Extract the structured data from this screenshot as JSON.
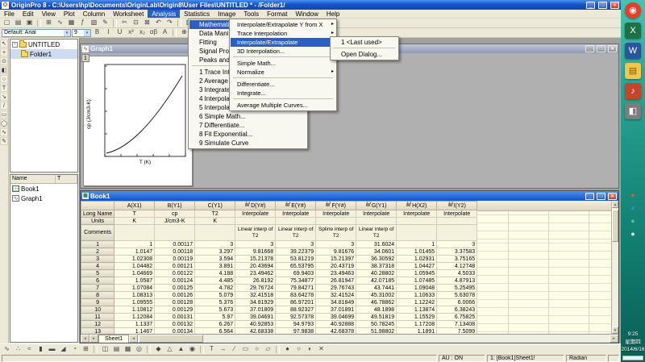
{
  "window": {
    "title": "OriginPro 8 - C:\\Users\\hp\\Documents\\OriginLab\\Origin8\\User Files\\UNTITLED * - /Folder1/",
    "app_icon_glyph": "O"
  },
  "window_controls": {
    "minimize": "_",
    "maximize": "□",
    "close": "✕"
  },
  "glyphs": {
    "submenu_arrow": "▸",
    "dropdown_arrow": "▾",
    "scroll_up": "▴",
    "scroll_down": "▾",
    "scroll_left": "◂",
    "scroll_right": "▸",
    "collapse": "-"
  },
  "menu_bar": {
    "items": [
      {
        "label": "File"
      },
      {
        "label": "Edit"
      },
      {
        "label": "View"
      },
      {
        "label": "Plot"
      },
      {
        "label": "Column"
      },
      {
        "label": "Worksheet"
      },
      {
        "label": "Analysis",
        "active": true
      },
      {
        "label": "Statistics"
      },
      {
        "label": "Image"
      },
      {
        "label": "Tools"
      },
      {
        "label": "Format"
      },
      {
        "label": "Window"
      },
      {
        "label": "Help"
      }
    ]
  },
  "analysis_menu": {
    "items": [
      {
        "label": "Mathematics",
        "sub": true,
        "hl": true
      },
      {
        "label": "Data Manipulation",
        "sub": true
      },
      {
        "label": "Fitting",
        "sub": true
      },
      {
        "label": "Signal Processing",
        "sub": true
      },
      {
        "label": "Peaks and Baseline",
        "sub": true
      },
      {
        "sep": true
      },
      {
        "label": "1 Trace Interpolation..."
      },
      {
        "label": "2 Average Multiple Curves..."
      },
      {
        "label": "3 Integrate..."
      },
      {
        "label": "4 Interpolate/Extrapolate Y from X..."
      },
      {
        "label": "5 Interpolate/Extrapolate..."
      },
      {
        "label": "6 Simple Math..."
      },
      {
        "label": "7 Differentiate..."
      },
      {
        "label": "8 Fit Exponential..."
      },
      {
        "label": "9 Simulate Curve"
      }
    ]
  },
  "mathematics_menu": {
    "items": [
      {
        "label": "Interpolate/Extrapolate Y from X",
        "sub": true
      },
      {
        "label": "Trace Interpolation",
        "sub": true
      },
      {
        "label": "Interpolate/Extrapolate",
        "sub": true,
        "hl": true
      },
      {
        "label": "3D Interpolation..."
      },
      {
        "sep": true
      },
      {
        "label": "Simple Math..."
      },
      {
        "label": "Normalize",
        "sub": true
      },
      {
        "sep": true
      },
      {
        "label": "Differentiate..."
      },
      {
        "label": "Integrate..."
      },
      {
        "sep": true
      },
      {
        "label": "Average Multiple Curves..."
      }
    ]
  },
  "interpolate_menu": {
    "items": [
      {
        "label": "1 <Last used>"
      },
      {
        "sep": true
      },
      {
        "label": "Open Dialog..."
      }
    ]
  },
  "toolbars": {
    "standard": [
      {
        "name": "new-project-icon",
        "glyph": "▢"
      },
      {
        "name": "open-project-icon",
        "glyph": "▤"
      },
      {
        "name": "save-project-icon",
        "glyph": "▣"
      },
      "|",
      {
        "name": "new-workbook-icon",
        "glyph": "⊞"
      },
      {
        "name": "new-graph-icon",
        "glyph": "∿"
      },
      {
        "name": "new-matrix-icon",
        "glyph": "▦"
      },
      {
        "name": "new-function-icon",
        "glyph": "ƒ"
      },
      {
        "name": "new-layout-icon",
        "glyph": "▧"
      },
      {
        "name": "new-notes-icon",
        "glyph": "✎"
      },
      "|",
      {
        "name": "cut-icon",
        "glyph": "✂"
      },
      {
        "name": "copy-icon",
        "glyph": "⊡"
      },
      {
        "name": "paste-icon",
        "glyph": "⊠"
      },
      {
        "name": "undo-icon",
        "glyph": "↶"
      },
      {
        "name": "redo-icon",
        "glyph": "↷"
      },
      "|",
      {
        "name": "project-explorer-icon",
        "glyph": "▥"
      },
      {
        "name": "results-log-icon",
        "glyph": "≡"
      },
      {
        "name": "script-window-icon",
        "glyph": "Σ"
      },
      {
        "name": "code-builder-icon",
        "glyph": "◫"
      },
      {
        "name": "help-icon",
        "glyph": "?"
      }
    ],
    "format": {
      "font_combo": "Default: Arial",
      "size_combo": "9",
      "buttons": [
        {
          "name": "bold-button",
          "glyph": "B"
        },
        {
          "name": "italic-button",
          "glyph": "I"
        },
        {
          "name": "underline-button",
          "glyph": "U"
        },
        {
          "name": "superscript-button",
          "glyph": "x²"
        },
        {
          "name": "subscript-button",
          "glyph": "x₂"
        },
        {
          "name": "greek-button",
          "glyph": "αβ"
        },
        {
          "name": "font-color-button",
          "glyph": "A"
        }
      ],
      "extra": [
        {
          "name": "add-layer-icon",
          "glyph": "⊕"
        },
        {
          "name": "extract-layer-icon",
          "glyph": "⊖"
        },
        {
          "name": "merge-graph-icon",
          "glyph": "⊞"
        },
        {
          "name": "rescale-axes-icon",
          "glyph": "⇄"
        },
        {
          "name": "zoom-in-icon",
          "glyph": "+"
        },
        {
          "name": "zoom-out-icon",
          "glyph": "−"
        },
        {
          "name": "whole-page-view-icon",
          "glyph": "▭"
        },
        {
          "name": "duplicate-window-icon",
          "glyph": "◫"
        }
      ]
    },
    "bottom": [
      [
        {
          "name": "line-plot-icon",
          "glyph": "∿"
        },
        {
          "name": "scatter-plot-icon",
          "glyph": "∴"
        },
        {
          "name": "line-symbol-plot-icon",
          "glyph": "≈"
        },
        {
          "name": "column-plot-icon",
          "glyph": "▮"
        },
        {
          "name": "bar-plot-icon",
          "glyph": "▬"
        },
        {
          "name": "area-plot-icon",
          "glyph": "◢"
        },
        {
          "name": "pie-chart-icon",
          "glyph": "◔"
        },
        {
          "name": "template-library-icon",
          "glyph": "⊞"
        }
      ],
      [
        {
          "name": "double-y-plot-icon",
          "glyph": "◫"
        },
        {
          "name": "stack-plot-icon",
          "glyph": "▤"
        },
        {
          "name": "multi-panel-plot-icon",
          "glyph": "▦"
        },
        {
          "name": "polar-plot-icon",
          "glyph": "◎"
        }
      ],
      [
        {
          "name": "3d-scatter-icon",
          "glyph": "◆"
        },
        {
          "name": "3d-surface-icon",
          "glyph": "△"
        },
        {
          "name": "3d-bar-icon",
          "glyph": "▲"
        },
        {
          "name": "contour-plot-icon",
          "glyph": "◉"
        }
      ],
      [
        {
          "name": "add-text-icon",
          "glyph": "T"
        },
        {
          "name": "add-arrow-icon",
          "glyph": "→"
        },
        {
          "name": "add-line-icon",
          "glyph": "∕"
        },
        {
          "name": "add-rectangle-icon",
          "glyph": "▭"
        },
        {
          "name": "add-circle-icon",
          "glyph": "○"
        },
        {
          "name": "add-polygon-icon",
          "glyph": "▱"
        }
      ],
      [
        {
          "name": "mask-points-icon",
          "glyph": "●"
        },
        {
          "name": "unmask-points-icon",
          "glyph": "○"
        },
        {
          "name": "toggle-mask-icon",
          "glyph": "◐"
        },
        {
          "name": "clear-mask-icon",
          "glyph": "✕"
        }
      ]
    ]
  },
  "tools_palette": [
    {
      "name": "pointer-tool-icon",
      "glyph": "↖"
    },
    {
      "name": "screen-reader-tool-icon",
      "glyph": "+"
    },
    {
      "name": "data-reader-tool-icon",
      "glyph": "⊙"
    },
    {
      "name": "data-selector-tool-icon",
      "glyph": "◧"
    },
    {
      "name": "zoom-tool-icon",
      "glyph": "○"
    },
    {
      "name": "text-tool-icon",
      "glyph": "T"
    },
    {
      "name": "arrow-tool-icon",
      "glyph": "↘"
    },
    {
      "name": "line-tool-icon",
      "glyph": "/"
    },
    {
      "name": "rectangle-tool-icon",
      "glyph": "▭"
    },
    {
      "name": "circle-tool-icon",
      "glyph": "◯"
    },
    {
      "name": "polyline-tool-icon",
      "glyph": "∿"
    },
    {
      "name": "freehand-tool-icon",
      "glyph": "✎"
    }
  ],
  "project_explorer": {
    "tree": [
      {
        "label": "UNTITLED"
      },
      {
        "label": "Folder1"
      }
    ],
    "list": {
      "columns": [
        "Name",
        "T"
      ],
      "items": [
        {
          "label": "Book1",
          "icon": "workbook-icon"
        },
        {
          "label": "Graph1",
          "icon": "graph-icon",
          "glyph": "∿"
        }
      ]
    }
  },
  "graph1": {
    "title": "Graph1",
    "icon_glyph": "∿",
    "layer_badge": "1",
    "x_axis_label": "T (K)",
    "y_axis_label": "cp (J/cm3-K)"
  },
  "book1": {
    "title": "Book1",
    "icon_glyph": "▦",
    "sheet_tab": "Sheet1",
    "row_labels": [
      "Long Name",
      "Units",
      "Comments"
    ],
    "columns": [
      "A(X1)",
      "B(Y1)",
      "C(Y1)",
      "D(Y#)",
      "E(Y#)",
      "F(Y#)",
      "G(Y1)",
      "H(X2)",
      "I(Y2)"
    ],
    "locked": [
      false,
      false,
      false,
      true,
      true,
      true,
      true,
      true,
      true
    ],
    "long_names": [
      "T",
      "cp",
      "T2",
      "Interpolate",
      "Interpolate",
      "Interpolate",
      "Interpolate",
      "Interpolate",
      "Interpolate"
    ],
    "units": [
      "K",
      "J/cm3-K",
      "K",
      "",
      "",
      "",
      "",
      "",
      ""
    ],
    "comments": [
      "",
      "",
      "",
      "Linear interp of T2",
      "Linear interp of T2",
      "Spline interp of T2",
      "Linear interp of T2",
      "",
      ""
    ],
    "rows": [
      [
        "1",
        "0.00117",
        "3",
        "3",
        "3",
        "3",
        "31.6024",
        "1",
        "3"
      ],
      [
        "1.0147",
        "0.00118",
        "3.297",
        "9.81668",
        "39.22379",
        "9.81676",
        "34.0601",
        "1.01455",
        "3.37583"
      ],
      [
        "1.02308",
        "0.00119",
        "3.594",
        "15.21378",
        "53.81219",
        "15.21397",
        "36.30592",
        "1.02931",
        "3.75165"
      ],
      [
        "1.04482",
        "0.00121",
        "3.891",
        "20.43694",
        "65.53795",
        "20.43719",
        "38.37318",
        "1.04427",
        "4.12748"
      ],
      [
        "1.04669",
        "0.00122",
        "4.188",
        "23.49462",
        "69.9403",
        "23.49463",
        "40.28802",
        "1.05945",
        "4.5033"
      ],
      [
        "1.0587",
        "0.00124",
        "4.485",
        "26.8192",
        "75.34877",
        "26.81947",
        "42.07185",
        "1.07485",
        "4.87913"
      ],
      [
        "1.07084",
        "0.00125",
        "4.782",
        "29.76724",
        "79.84271",
        "29.76743",
        "43.7441",
        "1.09048",
        "5.25495"
      ],
      [
        "1.08313",
        "0.00126",
        "5.079",
        "32.41518",
        "83.64278",
        "32.41524",
        "45.31002",
        "1.10633",
        "5.63078"
      ],
      [
        "1.09555",
        "0.00128",
        "5.376",
        "34.81929",
        "86.97201",
        "34.81849",
        "46.78862",
        "1.12242",
        "6.0066"
      ],
      [
        "1.10812",
        "0.00129",
        "5.673",
        "37.01809",
        "88.92327",
        "37.01891",
        "48.1898",
        "1.13874",
        "6.38243"
      ],
      [
        "1.12084",
        "0.00131",
        "5.97",
        "39.04691",
        "92.57378",
        "39.04699",
        "49.51819",
        "1.15529",
        "6.75825"
      ],
      [
        "1.1337",
        "0.00132",
        "6.267",
        "40.92853",
        "94.9793",
        "40.92888",
        "50.78245",
        "1.17208",
        "7.13408"
      ],
      [
        "1.1467",
        "0.00134",
        "6.564",
        "42.68338",
        "97.9838",
        "42.68378",
        "51.98802",
        "1.1891",
        "7.5099"
      ]
    ]
  },
  "status_bar": {
    "fields": [
      "AU : ON",
      "1: [Book1]Sheet1!",
      "Radian"
    ]
  },
  "taskbar": {
    "apps": [
      {
        "name": "browser-icon",
        "glyph": "◉",
        "bg": "#e2402a",
        "fg": "#fff",
        "round": true
      },
      {
        "name": "excel-icon",
        "glyph": "X",
        "bg": "#1e7145",
        "fg": "#fff"
      },
      {
        "name": "word-icon",
        "glyph": "W",
        "bg": "#2b579a",
        "fg": "#fff"
      },
      {
        "name": "folder-app-icon",
        "glyph": "▤",
        "bg": "#f3c64a",
        "fg": "#7a5a10"
      },
      {
        "name": "taskbar-app-icon-5",
        "glyph": "♪",
        "bg": "#c4452c",
        "fg": "#fff"
      },
      {
        "name": "taskbar-app-icon-6",
        "glyph": "◧",
        "bg": "#7d7d7d",
        "fg": "#fff"
      }
    ],
    "tray": [
      {
        "name": "tray-icon-1",
        "glyph": "●",
        "fg": "#e05a3a"
      },
      {
        "name": "tray-icon-2",
        "glyph": "●",
        "fg": "#4a7fd4"
      },
      {
        "name": "tray-icon-3",
        "glyph": "●",
        "fg": "#58c08a"
      },
      {
        "name": "tray-icon-4",
        "glyph": "●",
        "fg": "#e8e8e8"
      }
    ],
    "clock": {
      "time": "9:25",
      "weekday": "星期四",
      "date": "2014/6/16"
    }
  },
  "colors": {
    "titlebar_blue": "#1556c8",
    "menu_highlight": "#2a5fc5",
    "desktop_teal": "#1f9e8e",
    "sheet_background": "#fdfce6",
    "close_button_red": "#d23a1e"
  }
}
